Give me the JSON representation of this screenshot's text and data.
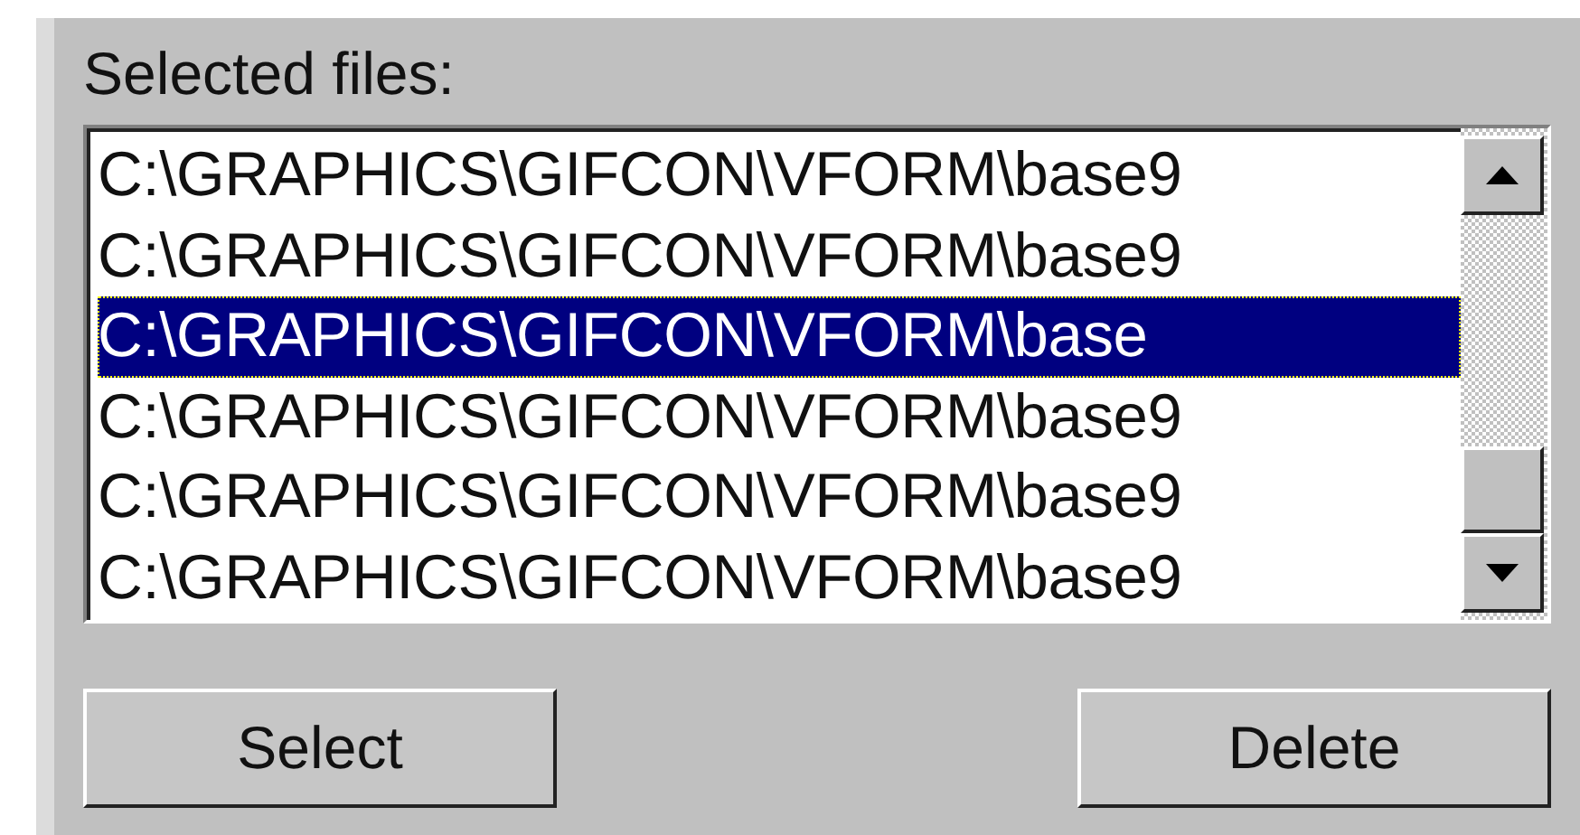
{
  "label": "Selected files:",
  "files": [
    {
      "path": "C:\\GRAPHICS\\GIFCON\\VFORM\\base9",
      "selected": false
    },
    {
      "path": "C:\\GRAPHICS\\GIFCON\\VFORM\\base9",
      "selected": false
    },
    {
      "path": "C:\\GRAPHICS\\GIFCON\\VFORM\\base",
      "selected": true
    },
    {
      "path": "C:\\GRAPHICS\\GIFCON\\VFORM\\base9",
      "selected": false
    },
    {
      "path": "C:\\GRAPHICS\\GIFCON\\VFORM\\base9",
      "selected": false
    },
    {
      "path": "C:\\GRAPHICS\\GIFCON\\VFORM\\base9",
      "selected": false
    }
  ],
  "buttons": [
    "Select",
    "Delete"
  ]
}
